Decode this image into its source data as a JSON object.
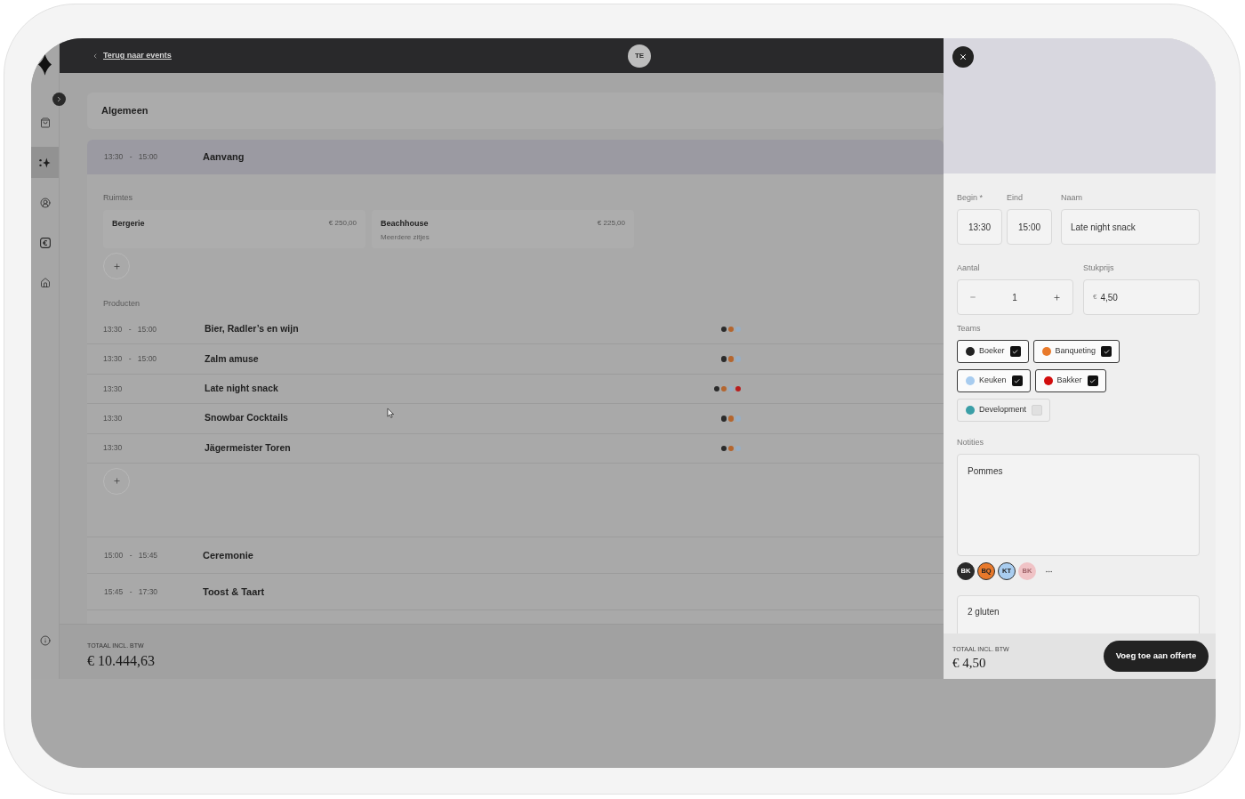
{
  "sidebar": {
    "items": [
      {
        "selected": false
      },
      {
        "selected": true
      },
      {
        "selected": false
      },
      {
        "selected": false
      },
      {
        "selected": false
      }
    ]
  },
  "header": {
    "back_link": "Terug naar events",
    "avatar": "TE"
  },
  "general": {
    "title": "Algemeen"
  },
  "sections": [
    {
      "time": "13:30 - 15:00",
      "title": "Aanvang",
      "expanded": true,
      "rooms_label": "Ruimtes",
      "rooms": [
        {
          "name": "Bergerie",
          "price": "€ 250,00"
        },
        {
          "name": "Beachhouse",
          "price": "€ 225,00",
          "note": "Meerdere zitjes"
        }
      ],
      "products_label": "Producten",
      "products": [
        {
          "time": "13:30 - 15:00",
          "name": "Bier, Radler’s en wijn",
          "teams": [
            {
              "color": "#2b2b2b"
            },
            {
              "color": "#b4662f"
            },
            {
              "color": "#98afc5"
            }
          ]
        },
        {
          "time": "13:30 - 15:00",
          "name": "Zalm amuse",
          "teams": [
            {
              "color": "#2b2b2b"
            },
            {
              "color": "#b4662f"
            },
            {
              "color": "#98afc5"
            }
          ]
        },
        {
          "time": "13:30",
          "name": "Late night snack",
          "teams": [
            {
              "color": "#2b2b2b"
            },
            {
              "color": "#b4662f"
            },
            {
              "color": "#98afc5"
            },
            {
              "color": "#b81e1e"
            }
          ]
        },
        {
          "time": "13:30",
          "name": "Snowbar Cocktails",
          "teams": [
            {
              "color": "#2b2b2b"
            },
            {
              "color": "#b4662f"
            },
            {
              "color": "#98afc5"
            }
          ]
        },
        {
          "time": "13:30",
          "name": "Jägermeister Toren",
          "teams": [
            {
              "color": "#2b2b2b"
            },
            {
              "color": "#b4662f"
            },
            {
              "color": "#98afc5"
            }
          ]
        }
      ]
    },
    {
      "time": "15:00 - 15:45",
      "title": "Ceremonie",
      "expanded": false
    },
    {
      "time": "15:45 - 17:30",
      "title": "Toost & Taart",
      "expanded": false
    }
  ],
  "footer": {
    "total_label": "TOTAAL INCL. BTW",
    "total": "€ 10.444,63"
  },
  "panel": {
    "fields": [
      {
        "label": "Begin *",
        "value": "13:30"
      },
      {
        "label": "Eind",
        "value": "15:00"
      },
      {
        "label": "Naam",
        "value": "Late night snack"
      }
    ],
    "quantity": {
      "label": "Aantal",
      "value": "1"
    },
    "unit_price": {
      "label": "Stukprijs",
      "currency": "€",
      "value": "4,50"
    },
    "teams": {
      "label": "Teams",
      "items": [
        {
          "name": "Boeker",
          "color": "#232323",
          "checked": true
        },
        {
          "name": "Banqueting",
          "color": "#e8792a",
          "checked": true
        },
        {
          "name": "Keuken",
          "color": "#a8ccef",
          "checked": true
        },
        {
          "name": "Bakker",
          "color": "#d20d0d",
          "checked": true
        },
        {
          "name": "Development",
          "color": "#3b9fa7",
          "checked": false
        }
      ]
    },
    "notes": {
      "label": "Notities",
      "value": "Pommes"
    },
    "note_authors": [
      {
        "initials": "BK",
        "color": "#2a2a2a",
        "faded": false
      },
      {
        "initials": "BQ",
        "color": "#e8792b",
        "faded": false
      },
      {
        "initials": "KT",
        "color": "#a9cdf0",
        "faded": false
      },
      {
        "initials": "BK",
        "color": "#f0c3c6",
        "faded": true
      }
    ],
    "second_note": {
      "value": "2 gluten"
    },
    "footer": {
      "total_label": "TOTAAL INCL. BTW",
      "total": "€ 4,50",
      "button": "Voeg toe aan offerte"
    }
  }
}
